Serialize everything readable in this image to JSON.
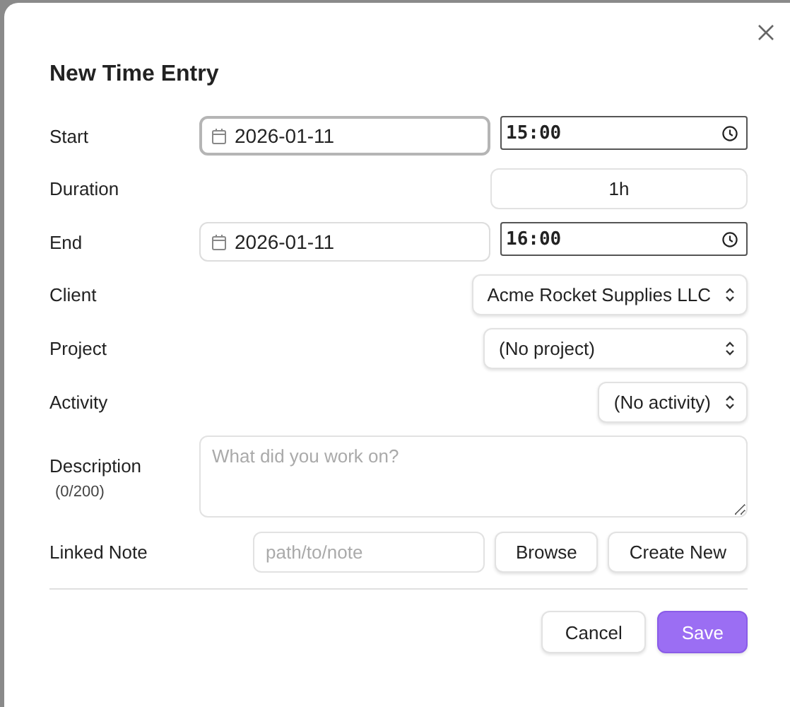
{
  "dialog": {
    "title": "New Time Entry",
    "fields": [
      {
        "kind": "datetime",
        "label": "Start",
        "date": "2026-01-11",
        "time": "15:00",
        "focused": true
      },
      {
        "kind": "text",
        "label": "Duration",
        "value": "1h"
      },
      {
        "kind": "datetime",
        "label": "End",
        "date": "2026-01-11",
        "time": "16:00",
        "focused": false
      },
      {
        "kind": "select",
        "label": "Client",
        "value": "Acme Rocket Supplies LLC"
      },
      {
        "kind": "select",
        "label": "Project",
        "value": "(No project)"
      },
      {
        "kind": "select",
        "label": "Activity",
        "value": "(No activity)"
      },
      {
        "kind": "textarea",
        "label": "Description",
        "counter": "(0/200)",
        "placeholder": "What did you work on?"
      },
      {
        "kind": "note",
        "label": "Linked Note",
        "placeholder": "path/to/note",
        "buttons": [
          "Browse",
          "Create New"
        ]
      }
    ],
    "actions": [
      {
        "label": "Cancel",
        "primary": false
      },
      {
        "label": "Save",
        "primary": true
      }
    ]
  }
}
